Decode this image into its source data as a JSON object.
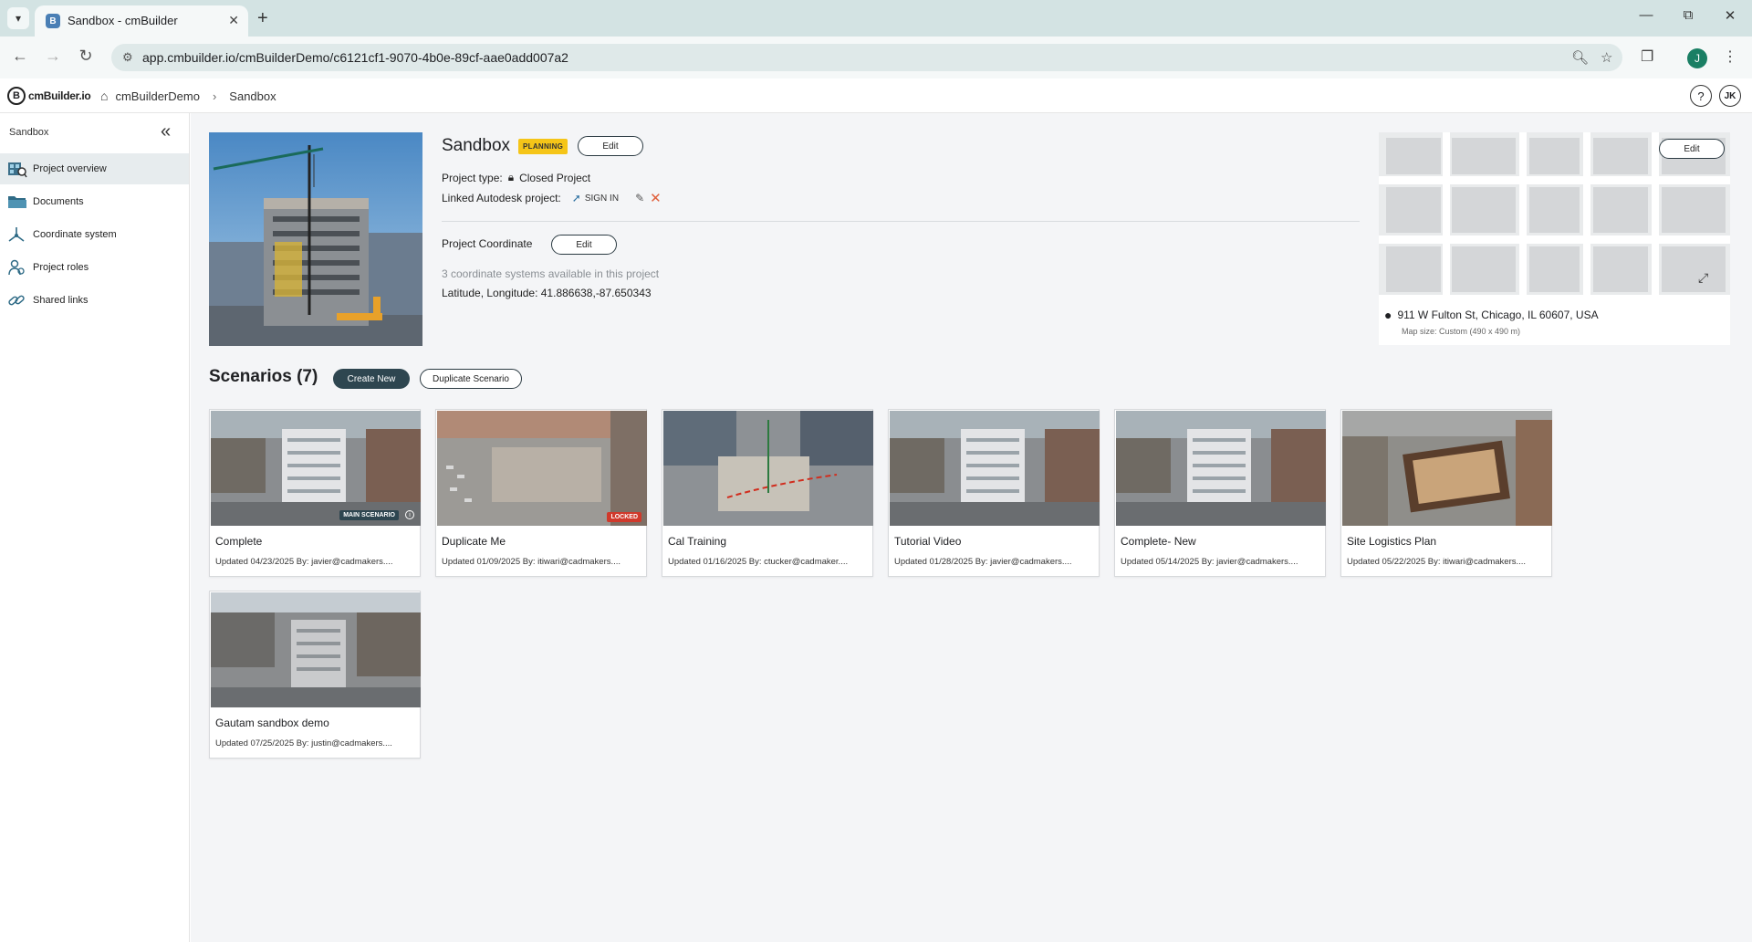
{
  "browser": {
    "tab_title": "Sandbox - cmBuilder",
    "url": "app.cmbuilder.io/cmBuilderDemo/c6121cf1-9070-4b0e-89cf-aae0add007a2",
    "profile_initial": "J"
  },
  "header": {
    "logo_text": "cmBuilder.io",
    "breadcrumb_home": "cmBuilderDemo",
    "breadcrumb_current": "Sandbox",
    "help_label": "?",
    "user_initials": "JK"
  },
  "sidebar": {
    "title": "Sandbox",
    "items": [
      {
        "label": "Project overview",
        "icon": "project-overview-icon"
      },
      {
        "label": "Documents",
        "icon": "folder-icon"
      },
      {
        "label": "Coordinate system",
        "icon": "axes-icon"
      },
      {
        "label": "Project roles",
        "icon": "user-roles-icon"
      },
      {
        "label": "Shared links",
        "icon": "link-icon"
      }
    ]
  },
  "project": {
    "name": "Sandbox",
    "status_badge": "PLANNING",
    "edit_label": "Edit",
    "type_label": "Project type:",
    "type_value": "Closed Project",
    "autodesk_label": "Linked Autodesk project:",
    "signin_label": "SIGN IN",
    "coordinate_label": "Project Coordinate",
    "coordinate_edit_label": "Edit",
    "coordinate_systems_text": "3 coordinate systems available in this project",
    "latlong_text": "Latitude, Longitude: 41.886638,-87.650343"
  },
  "map": {
    "edit_label": "Edit",
    "address": "911 W Fulton St, Chicago, IL 60607, USA",
    "map_size": "Map size: Custom (490 x 490 m)"
  },
  "scenarios": {
    "title": "Scenarios (7)",
    "create_label": "Create New",
    "duplicate_label": "Duplicate Scenario",
    "items": [
      {
        "title": "Complete",
        "meta": "Updated 04/23/2025 By: javier@cadmakers....",
        "tag": "MAIN SCENARIO"
      },
      {
        "title": "Duplicate Me",
        "meta": "Updated 01/09/2025 By: itiwari@cadmakers....",
        "tag": "LOCKED"
      },
      {
        "title": "Cal Training",
        "meta": "Updated 01/16/2025 By: ctucker@cadmaker....",
        "tag": ""
      },
      {
        "title": "Tutorial Video",
        "meta": "Updated 01/28/2025 By: javier@cadmakers....",
        "tag": ""
      },
      {
        "title": "Complete- New",
        "meta": "Updated 05/14/2025 By: javier@cadmakers....",
        "tag": ""
      },
      {
        "title": "Site Logistics Plan",
        "meta": "Updated 05/22/2025 By: itiwari@cadmakers....",
        "tag": ""
      },
      {
        "title": "Gautam sandbox demo",
        "meta": "Updated 07/25/2025 By: justin@cadmakers....",
        "tag": ""
      }
    ]
  }
}
